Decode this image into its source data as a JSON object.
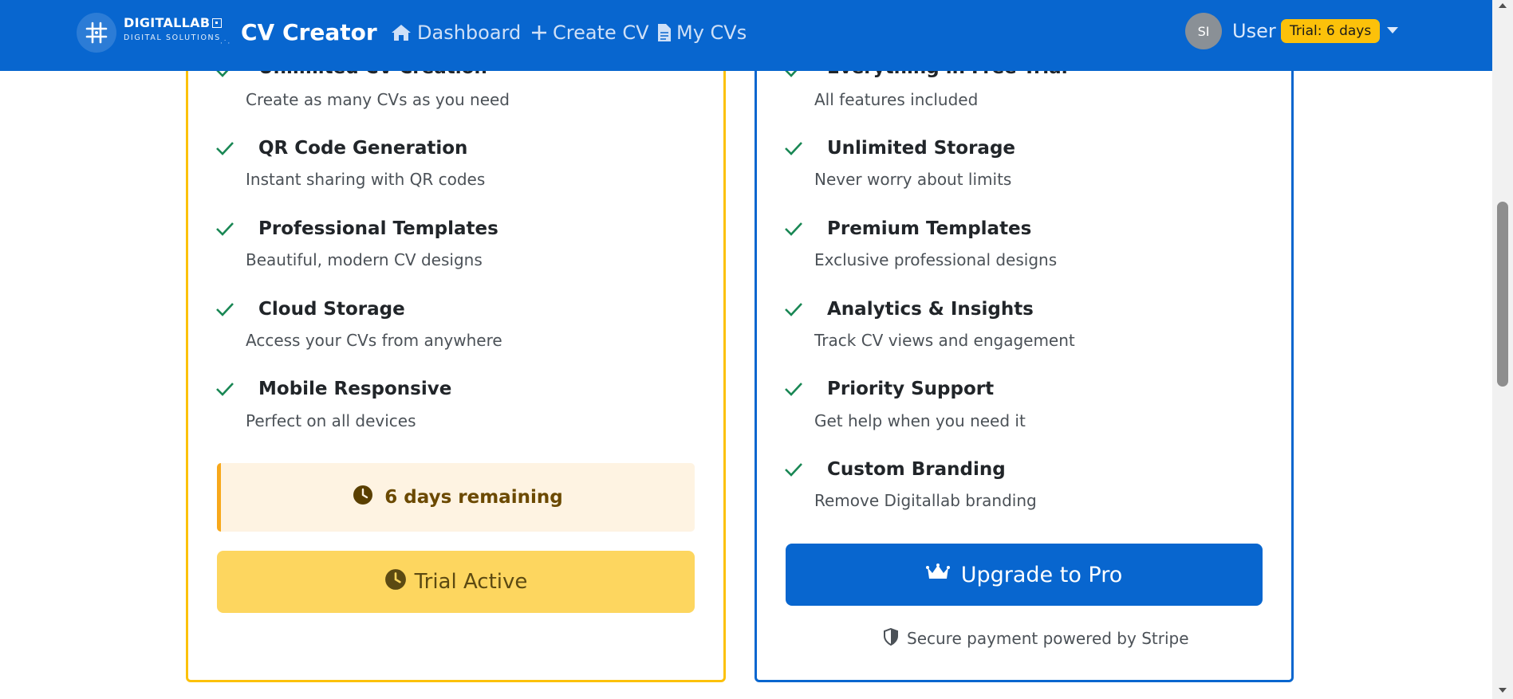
{
  "navbar": {
    "logo_name": "DIGITALLAB",
    "logo_subtitle": "DIGITAL SOLUTIONS",
    "brand": "CV Creator",
    "links": [
      {
        "label": "Dashboard",
        "icon": "home-icon"
      },
      {
        "label": "Create CV",
        "icon": "plus-icon"
      },
      {
        "label": "My CVs",
        "icon": "file-icon"
      }
    ],
    "avatar_initials": "SI",
    "user_name": "User",
    "trial_badge": "Trial: 6 days",
    "colors": {
      "primary": "#0866cf",
      "badge": "#fcc10a"
    }
  },
  "trial_card": {
    "features": [
      {
        "title": "Unlimited CV Creation",
        "desc": "Create as many CVs as you need"
      },
      {
        "title": "QR Code Generation",
        "desc": "Instant sharing with QR codes"
      },
      {
        "title": "Professional Templates",
        "desc": "Beautiful, modern CV designs"
      },
      {
        "title": "Cloud Storage",
        "desc": "Access your CVs from anywhere"
      },
      {
        "title": "Mobile Responsive",
        "desc": "Perfect on all devices"
      }
    ],
    "remaining_text": "6 days remaining",
    "button_label": "Trial Active",
    "border_color": "#fcc10a"
  },
  "pro_card": {
    "features": [
      {
        "title": "Everything in Free Trial",
        "desc": "All features included"
      },
      {
        "title": "Unlimited Storage",
        "desc": "Never worry about limits"
      },
      {
        "title": "Premium Templates",
        "desc": "Exclusive professional designs"
      },
      {
        "title": "Analytics & Insights",
        "desc": "Track CV views and engagement"
      },
      {
        "title": "Priority Support",
        "desc": "Get help when you need it"
      },
      {
        "title": "Custom Branding",
        "desc": "Remove Digitallab branding"
      }
    ],
    "button_label": "Upgrade to Pro",
    "secure_note": "Secure payment powered by Stripe",
    "border_color": "#0866cf"
  }
}
